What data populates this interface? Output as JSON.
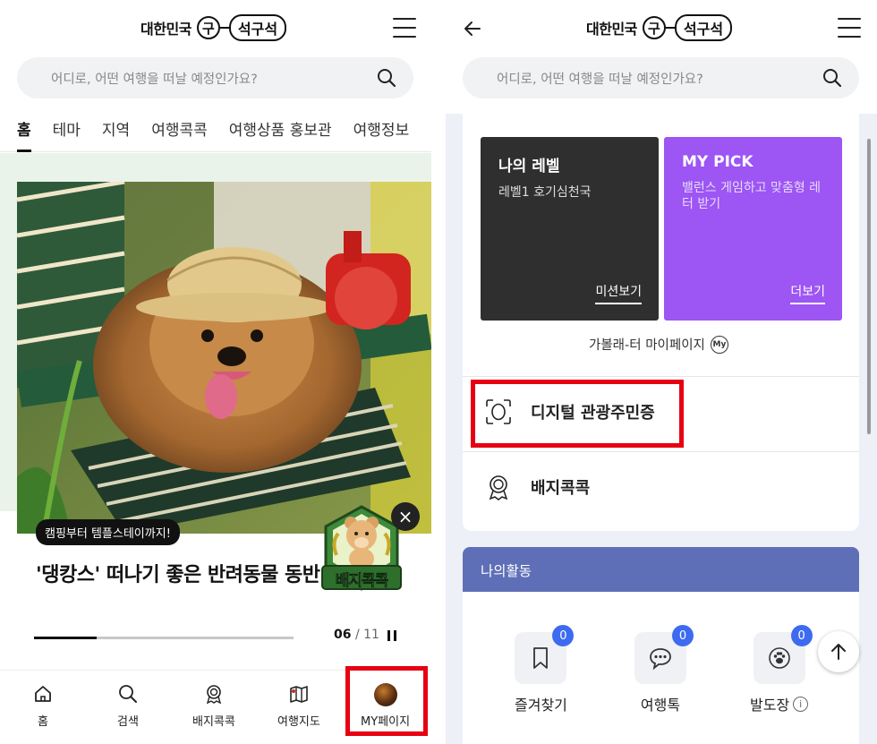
{
  "brand": {
    "korea_text": "대한민국",
    "gu_char": "구",
    "pill_text": "석구석"
  },
  "search": {
    "placeholder": "어디로, 어떤 여행을 떠날 예정인가요?"
  },
  "tabs": [
    {
      "label": "홈",
      "active": true
    },
    {
      "label": "테마"
    },
    {
      "label": "지역"
    },
    {
      "label": "여행콕콕"
    },
    {
      "label": "여행상품 홍보관"
    },
    {
      "label": "여행정보"
    }
  ],
  "hero": {
    "badge": "캠핑부터 템플스테이까지!",
    "title": "'댕캉스' 떠나기 좋은 반려동물 동반",
    "current": "06",
    "separator": "/",
    "total": "11",
    "progress": 0.24
  },
  "floating_badge": {
    "text": "배지콕콕",
    "close": "×"
  },
  "bottom_nav": [
    {
      "label": "홈",
      "icon": "home-icon"
    },
    {
      "label": "검색",
      "icon": "search-icon"
    },
    {
      "label": "배지콕콕",
      "icon": "badge-icon"
    },
    {
      "label": "여행지도",
      "icon": "map-icon"
    },
    {
      "label": "MY페이지",
      "icon": "avatar"
    }
  ],
  "mypage": {
    "level_card": {
      "title": "나의 레벨",
      "desc": "레벨1 호기심천국",
      "action": "미션보기"
    },
    "pick_card": {
      "title": "MY PICK",
      "desc": "밸런스 게임하고 맞춤형 레터 받기",
      "action": "더보기"
    },
    "mypage_link": "가볼래-터 마이페이지",
    "my_mark": "My",
    "menu": [
      {
        "label": "디지털 관광주민증",
        "icon": "face-scan-icon"
      },
      {
        "label": "배지콕콕",
        "icon": "medal-icon"
      }
    ],
    "activity": {
      "title": "나의활동",
      "items": [
        {
          "label": "즐겨찾기",
          "count": "0",
          "icon": "bookmark-icon"
        },
        {
          "label": "여행톡",
          "count": "0",
          "icon": "chat-bubble-icon"
        },
        {
          "label": "발도장",
          "count": "0",
          "icon": "paw-icon",
          "info": "i"
        }
      ]
    }
  },
  "colors": {
    "highlight": "#e60012",
    "purple_card": "#9d55f4",
    "dark_card": "#2f2f2f",
    "activity_header": "#5f6fb7",
    "count_badge": "#3d6bf0"
  }
}
